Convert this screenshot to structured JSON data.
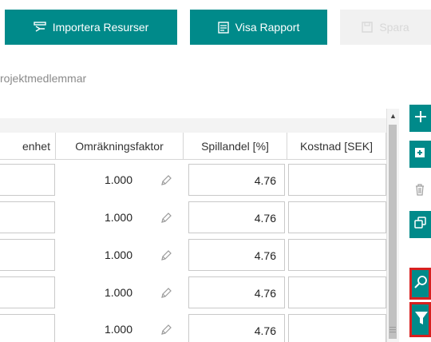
{
  "toolbar": {
    "import_label": "Importera Resurser",
    "report_label": "Visa Rapport",
    "save_label": "Spara"
  },
  "tab": {
    "label": "rojektmedlemmar"
  },
  "table": {
    "columns": [
      "enhet",
      "Omräkningsfaktor",
      "Spillandel [%]",
      "Kostnad [SEK]"
    ],
    "rows": [
      {
        "factor": "1.000",
        "waste": "4.76",
        "cost": ""
      },
      {
        "factor": "1.000",
        "waste": "4.76",
        "cost": ""
      },
      {
        "factor": "1.000",
        "waste": "4.76",
        "cost": ""
      },
      {
        "factor": "1.000",
        "waste": "4.76",
        "cost": ""
      },
      {
        "factor": "1.000",
        "waste": "4.76",
        "cost": ""
      }
    ]
  },
  "colors": {
    "accent": "#008a8a",
    "highlight": "#d8201f"
  },
  "icons": {
    "import": "import-icon",
    "report": "report-icon",
    "save": "save-icon",
    "edit": "pencil-icon",
    "add": "plus-icon",
    "add_file": "add-file-icon",
    "delete": "trash-icon",
    "copy": "copy-icon",
    "search": "search-icon",
    "filter": "filter-icon"
  }
}
